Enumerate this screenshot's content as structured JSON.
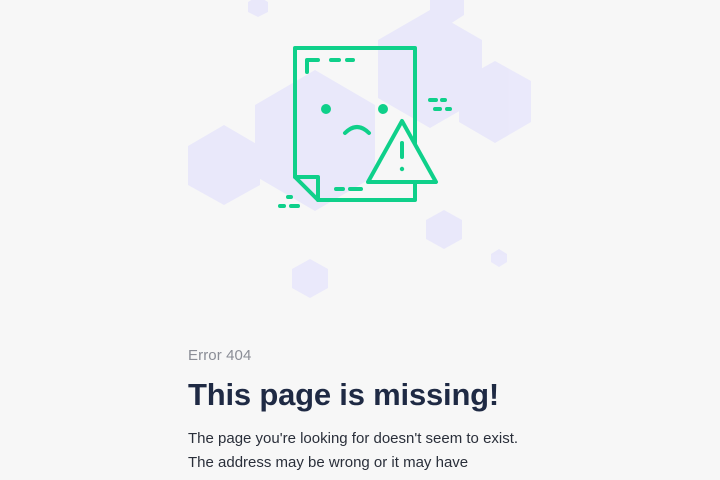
{
  "error": {
    "code_label": "Error 404",
    "headline": "This page is missing!",
    "body": "The page you're looking for doesn't seem to exist. The address may be wrong or it may have"
  },
  "illustration": {
    "icon": "missing-document-warning-icon",
    "accent_color": "#0fd08a",
    "hexagon_color": "#e7e6fb"
  }
}
